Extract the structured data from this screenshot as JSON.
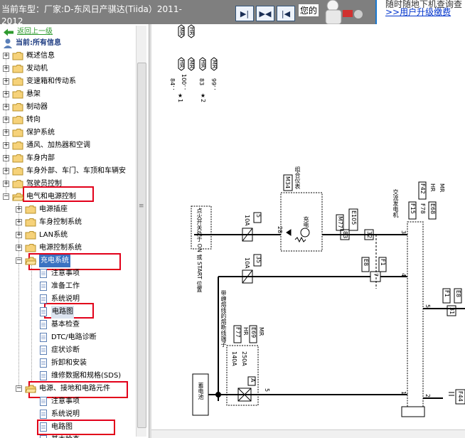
{
  "header": {
    "car_model_label": "当前车型：",
    "car_model_value": "厂家:D-东风日产骐达(Tiida）2011-",
    "car_model_value_2": "2012",
    "greeting": "您的",
    "promo_top": "随时随地下机查询查",
    "promo_link": ">>用户升级缴费",
    "nav_buttons": [
      "▶|",
      "▶◀",
      "|◀"
    ]
  },
  "tree": {
    "back_link": "返回上一级",
    "current": "当前:所有信息",
    "items": [
      "概述信息",
      "发动机",
      "变速箱和传动系",
      "悬架",
      "制动器",
      "转向",
      "保护系统",
      "通风、加热器和空调",
      "车身内部",
      "车身外部、车门、车顶和车辆安",
      "驾驶员控制",
      "电气和电源控制"
    ],
    "electrical_children": [
      "电源插座",
      "车身控制系统",
      "LAN系统",
      "电源控制系统",
      "充电系统"
    ],
    "charging_children": [
      "注意事项",
      "准备工作",
      "系统说明",
      "电路图",
      "基本检查",
      "DTC/电路诊断",
      "症状诊断",
      "拆卸和安装",
      "维修数据和规格(SDS)"
    ],
    "next_group": "电源、接地和电路元件",
    "next_group_children": [
      "注意事项",
      "系统说明",
      "电路图",
      "基本检查"
    ]
  },
  "diagram": {
    "top_connector_codes": [
      "MR",
      "HR"
    ],
    "year_rows": [
      {
        "year": "84：",
        "codes": [
          "HR",
          "HR"
        ]
      },
      {
        "year": "100：",
        "codes": [
          "MR",
          "MR"
        ]
      },
      {
        "year": "83",
        "codes": [
          "HR",
          "HR"
        ]
      },
      {
        "year": "99：",
        "codes": [
          "MR",
          "MR"
        ]
      }
    ],
    "note_marks": [
      "★1",
      "★2"
    ],
    "combo_meter": "组合仪表",
    "combo_code": "M34",
    "charge_label": "充电",
    "connectors": [
      "M77",
      "E105"
    ],
    "pins": [
      "28",
      "83",
      "32",
      "7",
      "E8",
      "F1",
      "4",
      "3",
      "1",
      "2",
      "5",
      "31"
    ],
    "fuse_10a": "10A",
    "fuse_10a_no": "5",
    "fuse_10a_2_no": "35",
    "ignition_label": "点火开关处于 ON 或 START 位置",
    "fusible_label": "带缠熔线的熔断线端子",
    "fusible_codes": [
      "F77",
      "HR",
      "E69",
      "MR"
    ],
    "fuse_140": "140A",
    "fuse_250": "250A",
    "fuse_a": "A",
    "battery": "蓄电池",
    "alternator": "交流发电机",
    "alternator_codes": [
      "F15",
      "F42",
      "F78",
      "HR",
      "E68",
      "MR"
    ],
    "right_codes": [
      "F1",
      "E8"
    ],
    "f44": "F44",
    "misc_pin": "5"
  }
}
